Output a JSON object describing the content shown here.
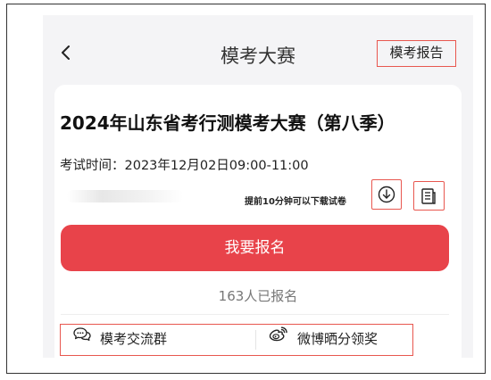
{
  "nav": {
    "title": "模考大赛",
    "report_label": "模考报告"
  },
  "exam": {
    "title": "2024年山东省考行测模考大赛（第八季）",
    "time_label": "考试时间：",
    "time_value": "2023年12月02日09:00-11:00",
    "download_hint": "提前10分钟可以下载试卷"
  },
  "actions": {
    "register_label": "我要报名",
    "register_count": "163人已报名"
  },
  "links": {
    "group_label": "模考交流群",
    "share_label": "微博晒分领奖"
  },
  "icons": {
    "back": "chevron-left-icon",
    "download": "download-circle-icon",
    "document": "document-icon",
    "chat": "chat-bubbles-icon",
    "weibo": "weibo-icon"
  },
  "colors": {
    "accent": "#e8434a",
    "highlight_border": "#e8574f",
    "background": "#f4f4f6"
  }
}
